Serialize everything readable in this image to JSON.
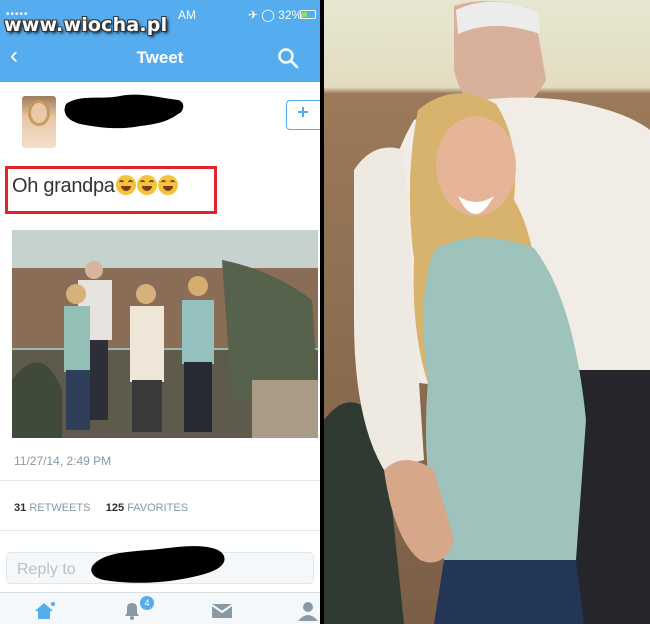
{
  "watermark": "www.wiocha.pl",
  "status_bar": {
    "signal": "•••••",
    "time": "AM",
    "battery": "32%"
  },
  "nav": {
    "back_icon": "chevron-left-icon",
    "title": "Tweet",
    "search_icon": "search-icon"
  },
  "tweet": {
    "follow_icon": "add-user-icon",
    "text": "Oh grandpa",
    "emoji": [
      "face-with-tears-of-joy",
      "face-with-tears-of-joy",
      "face-with-tears-of-joy"
    ],
    "timestamp": "11/27/14, 2:49 PM",
    "retweets_count": "31",
    "retweets_label": "RETWEETS",
    "favorites_count": "125",
    "favorites_label": "FAVORITES"
  },
  "reply": {
    "placeholder": "Reply to"
  },
  "tabbar": {
    "items": [
      "home-icon",
      "notifications-icon",
      "messages-icon",
      "profile-icon"
    ],
    "notification_badge": "4"
  },
  "colors": {
    "twitter_blue": "#55acee",
    "highlight_red": "#e2232a"
  }
}
